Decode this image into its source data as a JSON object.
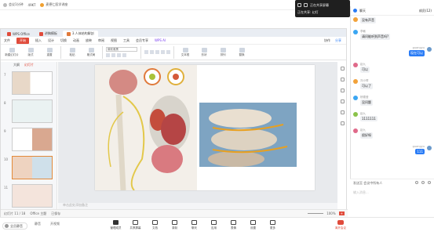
{
  "meeting_top": {
    "tags": [
      "会议1分钟",
      "49KT",
      "(placeholder)"
    ],
    "title": "麦德仁医学讲座",
    "tags_extra": "会议号 00000"
  },
  "share_bar": {
    "line1": "正在共享屏幕",
    "line2": "正在共享: 幻灯",
    "line2b": "共享中"
  },
  "wps": {
    "tabs": [
      {
        "label": "WPS Office",
        "color": "#e04b3b"
      },
      {
        "label": "讲稿模板",
        "color": "#e04b3b"
      },
      {
        "label": "3.人体结构解剖",
        "color": "#e07a3b",
        "active": true
      }
    ],
    "menu": [
      "文件",
      "开始",
      "插入",
      "设计",
      "切换",
      "动画",
      "放映",
      "审阅",
      "视图",
      "工具",
      "会员专享",
      "WPS AI"
    ],
    "menu_right": [
      "协作",
      "分享"
    ],
    "ribbon": [
      "新建幻灯片",
      "版式",
      "重置",
      "节",
      "粘贴",
      "格式刷",
      "文本框",
      "形状",
      "排列",
      "替换"
    ],
    "font_box": "微软雅黑",
    "panel": {
      "tab1": "大纲",
      "tab2": "幻灯片"
    },
    "slide_numbers": [
      "7",
      "8",
      "9",
      "10",
      "11"
    ],
    "notes_placeholder": "单击此处添加备注",
    "status": [
      "幻灯片 11 / 18",
      "Office 主题",
      "已保存"
    ],
    "zoom": "100%",
    "zoom_btn": "+"
  },
  "chat": {
    "header": "聊天",
    "count": "成员(12)",
    "messages": [
      {
        "sender": "",
        "text": "没有声音",
        "me": false
      },
      {
        "sender": "李敏",
        "text": "请问能听到声音吗?",
        "me": false
      },
      {
        "sender": "guangyu",
        "text": "现在可以",
        "me": true
      },
      {
        "sender": "赵九",
        "text": "可以",
        "me": false
      },
      {
        "sender": "刘小琴",
        "text": "可以了",
        "me": false
      },
      {
        "sender": "杨雪莹",
        "text": "没问题",
        "me": false
      },
      {
        "sender": "赵九",
        "text": "1111111",
        "me": false
      },
      {
        "sender": "赵九",
        "text": "很好呀",
        "me": false
      },
      {
        "sender": "guangyu",
        "text": "111",
        "me": true
      }
    ],
    "input_label": "发送至 会议中所有人",
    "input_placeholder": "输入消息..."
  },
  "bottom": {
    "me_label": "全员静音",
    "left": [
      "静音",
      "开视频"
    ],
    "items": [
      "管理成员",
      "共享屏幕",
      "文档",
      "录制",
      "聊天",
      "应用",
      "表情",
      "设置",
      "更多"
    ],
    "end": "离开会议"
  }
}
